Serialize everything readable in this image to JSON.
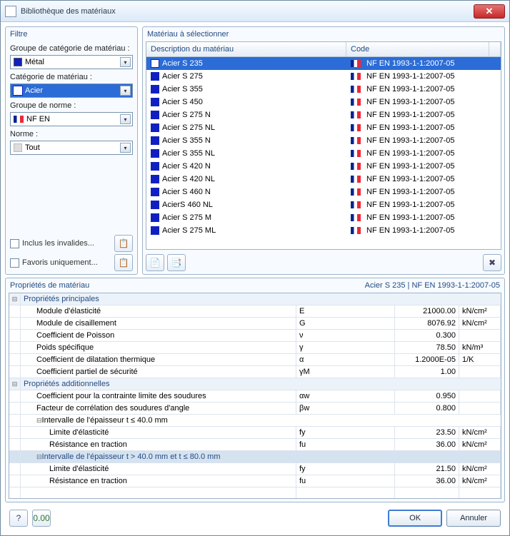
{
  "window": {
    "title": "Bibliothèque des matériaux"
  },
  "filter": {
    "title": "Filtre",
    "group_cat_label": "Groupe de catégorie de matériau :",
    "group_cat_value": "Métal",
    "cat_label": "Catégorie de matériau :",
    "cat_value": "Acier",
    "norm_group_label": "Groupe de norme :",
    "norm_group_value": "NF EN",
    "norm_label": "Norme :",
    "norm_value": "Tout",
    "include_invalid": "Inclus les invalides...",
    "fav_only": "Favoris uniquement..."
  },
  "material_list": {
    "title": "Matériau à sélectionner",
    "col_desc": "Description du matériau",
    "col_code": "Code",
    "items": [
      {
        "desc": "Acier  S 235",
        "code": "NF EN 1993-1-1:2007-05",
        "selected": true
      },
      {
        "desc": "Acier  S 275",
        "code": "NF EN 1993-1-1:2007-05"
      },
      {
        "desc": "Acier  S 355",
        "code": "NF EN 1993-1-1:2007-05"
      },
      {
        "desc": "Acier  S 450",
        "code": "NF EN 1993-1-1:2007-05"
      },
      {
        "desc": "Acier  S 275 N",
        "code": "NF EN 1993-1-1:2007-05"
      },
      {
        "desc": "Acier  S 275 NL",
        "code": "NF EN 1993-1-1:2007-05"
      },
      {
        "desc": "Acier  S 355 N",
        "code": "NF EN 1993-1-1:2007-05"
      },
      {
        "desc": "Acier  S 355 NL",
        "code": "NF EN 1993-1-1:2007-05"
      },
      {
        "desc": "Acier  S 420 N",
        "code": "NF EN 1993-1-1:2007-05"
      },
      {
        "desc": "Acier S 420 NL",
        "code": "NF EN 1993-1-1:2007-05"
      },
      {
        "desc": "Acier S 460 N",
        "code": "NF EN 1993-1-1:2007-05"
      },
      {
        "desc": "AcierS 460 NL",
        "code": "NF EN 1993-1-1:2007-05"
      },
      {
        "desc": "Acier S 275 M",
        "code": "NF EN 1993-1-1:2007-05"
      },
      {
        "desc": "Acier S 275 ML",
        "code": "NF EN 1993-1-1:2007-05"
      }
    ]
  },
  "properties": {
    "title": "Propriétés de matériau",
    "context": "Acier  S 235  |  NF EN 1993-1-1:2007-05",
    "section_main": "Propriétés principales",
    "section_add": "Propriétés additionnelles",
    "rows_main": [
      {
        "name": "Module d'élasticité",
        "sym": "E",
        "val": "21000.00",
        "unit": "kN/cm²"
      },
      {
        "name": "Module de cisaillement",
        "sym": "G",
        "val": "8076.92",
        "unit": "kN/cm²"
      },
      {
        "name": "Coefficient de Poisson",
        "sym": "ν",
        "val": "0.300",
        "unit": ""
      },
      {
        "name": "Poids spécifique",
        "sym": "γ",
        "val": "78.50",
        "unit": "kN/m³"
      },
      {
        "name": "Coefficient de dilatation thermique",
        "sym": "α",
        "val": "1.2000E-05",
        "unit": "1/K"
      },
      {
        "name": "Coefficient partiel de sécurité",
        "sym": "γM",
        "val": "1.00",
        "unit": ""
      }
    ],
    "rows_add1": [
      {
        "name": "Coefficient pour la contrainte limite des soudures",
        "sym": "αw",
        "val": "0.950",
        "unit": ""
      },
      {
        "name": "Facteur de corrélation des soudures d'angle",
        "sym": "βw",
        "val": "0.800",
        "unit": ""
      }
    ],
    "interval1": "Intervalle de l'épaisseur t ≤ 40.0 mm",
    "rows_int1": [
      {
        "name": "Limite d'élasticité",
        "sym": "fy",
        "val": "23.50",
        "unit": "kN/cm²"
      },
      {
        "name": "Résistance en traction",
        "sym": "fu",
        "val": "36.00",
        "unit": "kN/cm²"
      }
    ],
    "interval2": "Intervalle de l'épaisseur t > 40.0 mm et t ≤ 80.0 mm",
    "rows_int2": [
      {
        "name": "Limite d'élasticité",
        "sym": "fy",
        "val": "21.50",
        "unit": "kN/cm²"
      },
      {
        "name": "Résistance en traction",
        "sym": "fu",
        "val": "36.00",
        "unit": "kN/cm²"
      }
    ]
  },
  "buttons": {
    "ok": "OK",
    "cancel": "Annuler"
  }
}
